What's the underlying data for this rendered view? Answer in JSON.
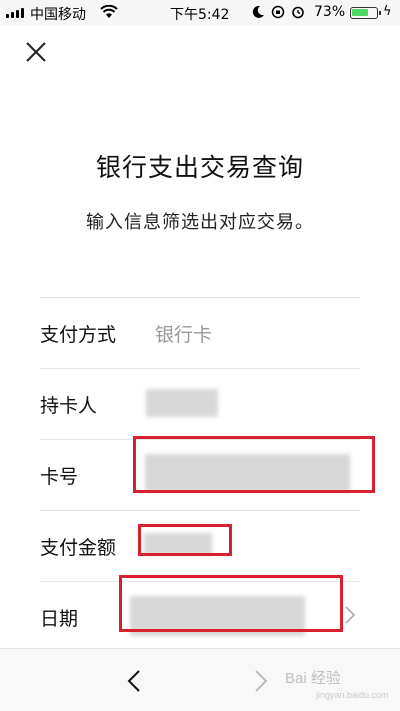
{
  "status_bar": {
    "carrier": "中国移动",
    "time": "下午5:42",
    "battery_percent": "73%",
    "battery_level": 0.73
  },
  "page": {
    "title": "银行支出交易查询",
    "subtitle": "输入信息筛选出对应交易。"
  },
  "form": {
    "rows": [
      {
        "label": "支付方式",
        "value": "银行卡"
      },
      {
        "label": "持卡人"
      },
      {
        "label": "卡号"
      },
      {
        "label": "支付金额"
      },
      {
        "label": "日期"
      }
    ]
  },
  "watermark": {
    "brand": "Bai 经验",
    "url": "jingyan.baidu.com"
  },
  "colors": {
    "highlight": "#d82030",
    "battery": "#4cd964"
  }
}
